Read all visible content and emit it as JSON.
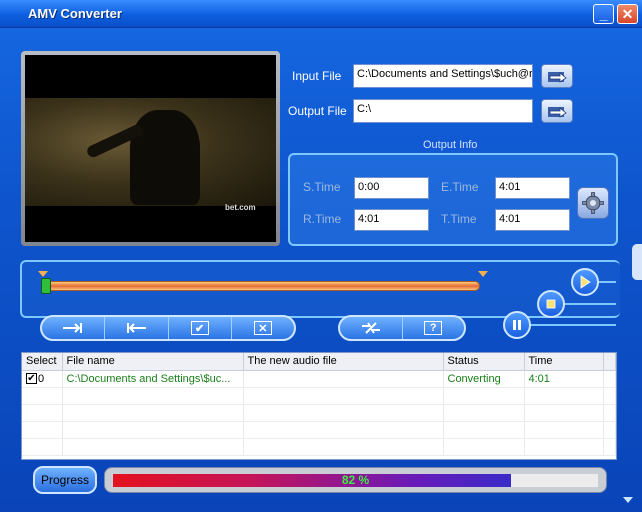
{
  "window": {
    "title": "AMV Converter"
  },
  "input": {
    "label": "Input File",
    "value": "C:\\Documents and Settings\\$uch@r"
  },
  "output": {
    "label": "Output File",
    "value": "C:\\"
  },
  "output_info": {
    "title": "Output Info",
    "s_time_label": "S.Time",
    "s_time": "0:00",
    "e_time_label": "E.Time",
    "e_time": "4:01",
    "r_time_label": "R.Time",
    "r_time": "4:01",
    "t_time_label": "T.Time",
    "t_time": "4:01"
  },
  "preview": {
    "logo": "bet.com"
  },
  "list": {
    "headers": [
      "Select",
      "File name",
      "The new audio file",
      "Status",
      "Time"
    ],
    "rows": [
      {
        "select": "0",
        "checked": true,
        "file_name": "C:\\Documents and Settings\\$uc...",
        "new_audio": "",
        "status": "Converting",
        "time": "4:01"
      }
    ]
  },
  "progress": {
    "button_label": "Progress",
    "percent": 82,
    "text": "82 %"
  },
  "icons": {
    "minimize": "minimize-icon",
    "close": "close-icon",
    "browse": "folder-arrow-icon",
    "settings": "gear-icon",
    "set_start": "set-start-icon",
    "set_end": "set-end-icon",
    "check": "check-all-icon",
    "uncheck": "uncheck-icon",
    "convert": "convert-icon",
    "help": "help-icon",
    "play": "play-icon",
    "stop": "stop-icon",
    "pause": "pause-icon"
  }
}
